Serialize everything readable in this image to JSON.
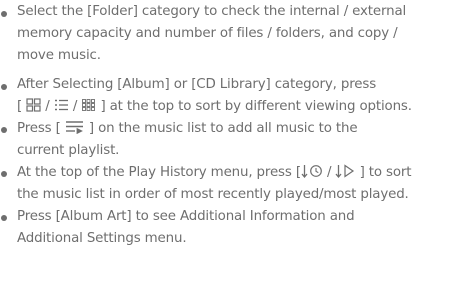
{
  "document": {
    "items": [
      {
        "lines": [
          "Select the [Folder] category to check the internal / external",
          "memory capacity and number of files / folders, and copy /",
          "move music."
        ]
      },
      {
        "lines": [
          "After Selecting  [Album] or [CD Library] category, press",
          {
            "before": "[ ",
            "icons": [
              "album-grid-icon",
              "list-view-icon",
              "small-grid-icon"
            ],
            "separator": " / ",
            "after": " ] at the top to sort by different viewing options."
          }
        ]
      },
      {
        "lines": [
          {
            "before": "Press [ ",
            "icons": [
              "add-all-to-playlist-icon"
            ],
            "after": " ] on the music list to add all music to the"
          },
          "current playlist."
        ]
      },
      {
        "lines": [
          {
            "before": "At the top of the Play History menu, press [",
            "icons": [
              "sort-recent-icon",
              "sort-most-played-icon"
            ],
            "separator": " / ",
            "after": " ] to sort"
          },
          "the music list in order of most recently played/most played."
        ]
      },
      {
        "lines": [
          "Press [Album Art] to see Additional Information and",
          "Additional Settings menu."
        ]
      }
    ]
  },
  "colors": {
    "text": "#6e6e6e",
    "background": "#ffffff"
  }
}
